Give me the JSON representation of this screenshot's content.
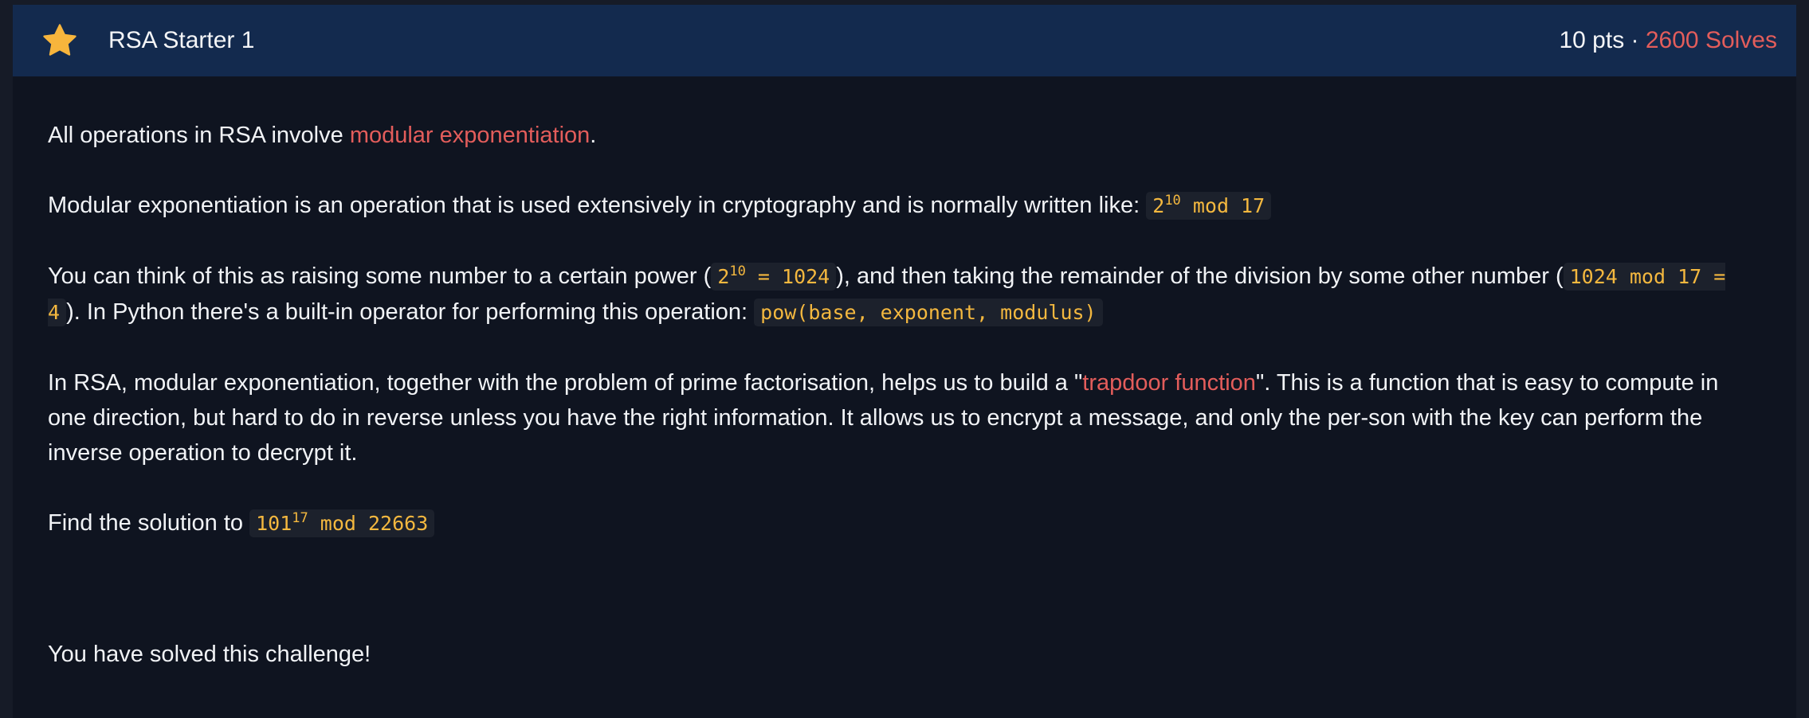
{
  "header": {
    "title": "RSA Starter 1",
    "points": "10 pts",
    "separator": " · ",
    "solves": "2600 Solves",
    "star_icon": "star-icon",
    "star_color": "#f7b53c"
  },
  "content": {
    "p1": {
      "pre": "All operations in RSA involve ",
      "link": "modular exponentiation",
      "post": "."
    },
    "p2": {
      "text": "Modular exponentiation is an operation that is used extensively in cryptography and is normally written like: ",
      "code_base": "2",
      "code_exp": "10",
      "code_rest": " mod 17"
    },
    "p3": {
      "text1": "You can think of this as raising some number to a certain power (",
      "code1_base": "2",
      "code1_exp": "10",
      "code1_rest": " = 1024",
      "text2": "), and then taking the remainder of the division by some other number (",
      "code2": "1024 mod 17 = 4",
      "text3": "). In Python there's a built-in operator for performing this operation: ",
      "code3": "pow(base, exponent, modulus)"
    },
    "p4": {
      "text1": "In RSA, modular exponentiation, together with the problem of prime factorisation, helps us to build a \"",
      "link": "trapdoor function",
      "text2": "\". This is a function that is easy to compute in one direction, but hard to do in reverse unless you have the right information. It allows us to encrypt a message, and only the per-son with the key can perform the inverse operation to decrypt it."
    },
    "p5": {
      "text": "Find the solution to ",
      "code_base": "101",
      "code_exp": "17",
      "code_rest": " mod 22663"
    },
    "solved_message": "You have solved this challenge!"
  },
  "colors": {
    "accent_red": "#e35d5b",
    "code_yellow": "#f4b83f",
    "header_bg": "#132a4e",
    "body_bg": "#0f1420"
  }
}
